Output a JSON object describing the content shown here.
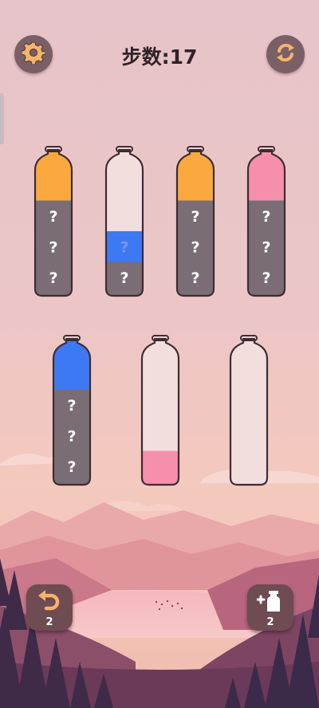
{
  "header": {
    "title": "步数:17",
    "settings_icon": "gear-icon",
    "restart_icon": "refresh-icon"
  },
  "colors": {
    "orange": "#fba93e",
    "blue": "#3d79f2",
    "pink": "#f58fab",
    "unknown": "#7a6d75",
    "glass": "#f3dede",
    "outline": "#3d2d33"
  },
  "bottles": [
    {
      "layers": [
        "unknown",
        "unknown",
        "unknown",
        "orange"
      ],
      "labels": [
        "?",
        "?",
        "?",
        ""
      ]
    },
    {
      "layers": [
        "unknown",
        "blue"
      ],
      "labels": [
        "?",
        "?"
      ]
    },
    {
      "layers": [
        "unknown",
        "unknown",
        "unknown",
        "orange"
      ],
      "labels": [
        "?",
        "?",
        "?",
        ""
      ]
    },
    {
      "layers": [
        "unknown",
        "unknown",
        "unknown",
        "pink"
      ],
      "labels": [
        "?",
        "?",
        "?",
        ""
      ]
    },
    {
      "layers": [
        "unknown",
        "unknown",
        "unknown",
        "blue"
      ],
      "labels": [
        "?",
        "?",
        "?",
        ""
      ]
    },
    {
      "layers": [
        "pink"
      ],
      "labels": [
        ""
      ]
    },
    {
      "layers": [],
      "labels": []
    }
  ],
  "powerups": {
    "undo": {
      "icon": "undo-icon",
      "count": "2"
    },
    "add_bottle": {
      "icon": "add-bottle-icon",
      "count": "2"
    }
  }
}
